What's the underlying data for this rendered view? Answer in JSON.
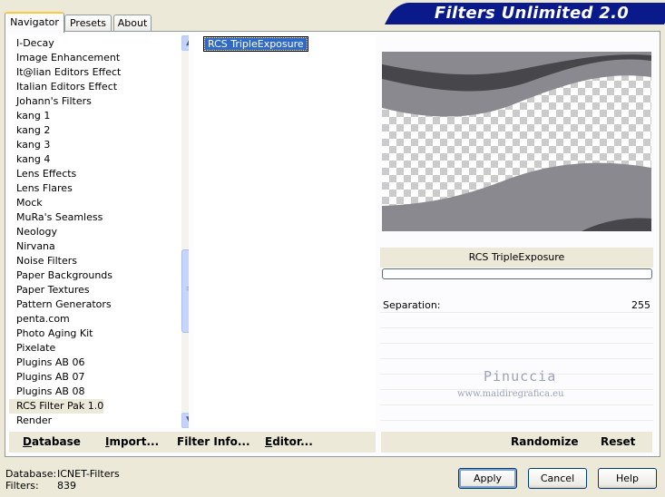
{
  "tabs": [
    "Navigator",
    "Presets",
    "About"
  ],
  "banner_title": "Filters Unlimited 2.0",
  "categories": [
    "I-Decay",
    "Image Enhancement",
    "It@lian Editors Effect",
    "Italian Editors Effect",
    "Johann's Filters",
    "kang 1",
    "kang 2",
    "kang 3",
    "kang 4",
    "Lens Effects",
    "Lens Flares",
    "Mock",
    "MuRa's Seamless",
    "Neology",
    "Nirvana",
    "Noise Filters",
    "Paper Backgrounds",
    "Paper Textures",
    "Pattern Generators",
    "penta.com",
    "Photo Aging Kit",
    "Pixelate",
    "Plugins AB 06",
    "Plugins AB 07",
    "Plugins AB 08",
    "RCS Filter Pak 1.0",
    "Render"
  ],
  "selected_category": "RCS Filter Pak 1.0",
  "selected_filter": "RCS TripleExposure",
  "filter_title": "RCS TripleExposure",
  "parameter": {
    "label": "Separation:",
    "value": "255"
  },
  "watermark": {
    "name": "Pinuccia",
    "site": "www.maidiregrafica.eu"
  },
  "left_buttons": [
    {
      "label": "Database",
      "underline": "D"
    },
    {
      "label": "Import...",
      "underline": "I"
    },
    {
      "label": "Filter Info...",
      "underline": ""
    },
    {
      "label": "Editor...",
      "underline": "E"
    }
  ],
  "right_buttons": [
    "Randomize",
    "Reset"
  ],
  "status": {
    "db_label": "Database:",
    "db_value": "ICNET-Filters",
    "filters_label": "Filters:",
    "filters_value": "839"
  },
  "dialog_buttons": {
    "apply": "Apply",
    "cancel": "Cancel",
    "help": "Help"
  },
  "icons": {
    "scroll_up": "chevron-up-icon",
    "scroll_down": "chevron-down-icon"
  },
  "colors": {
    "banner": "#0b1a8a",
    "selection": "#316ac5",
    "preview_gray": "#8a898f",
    "preview_dark": "#47464b"
  }
}
